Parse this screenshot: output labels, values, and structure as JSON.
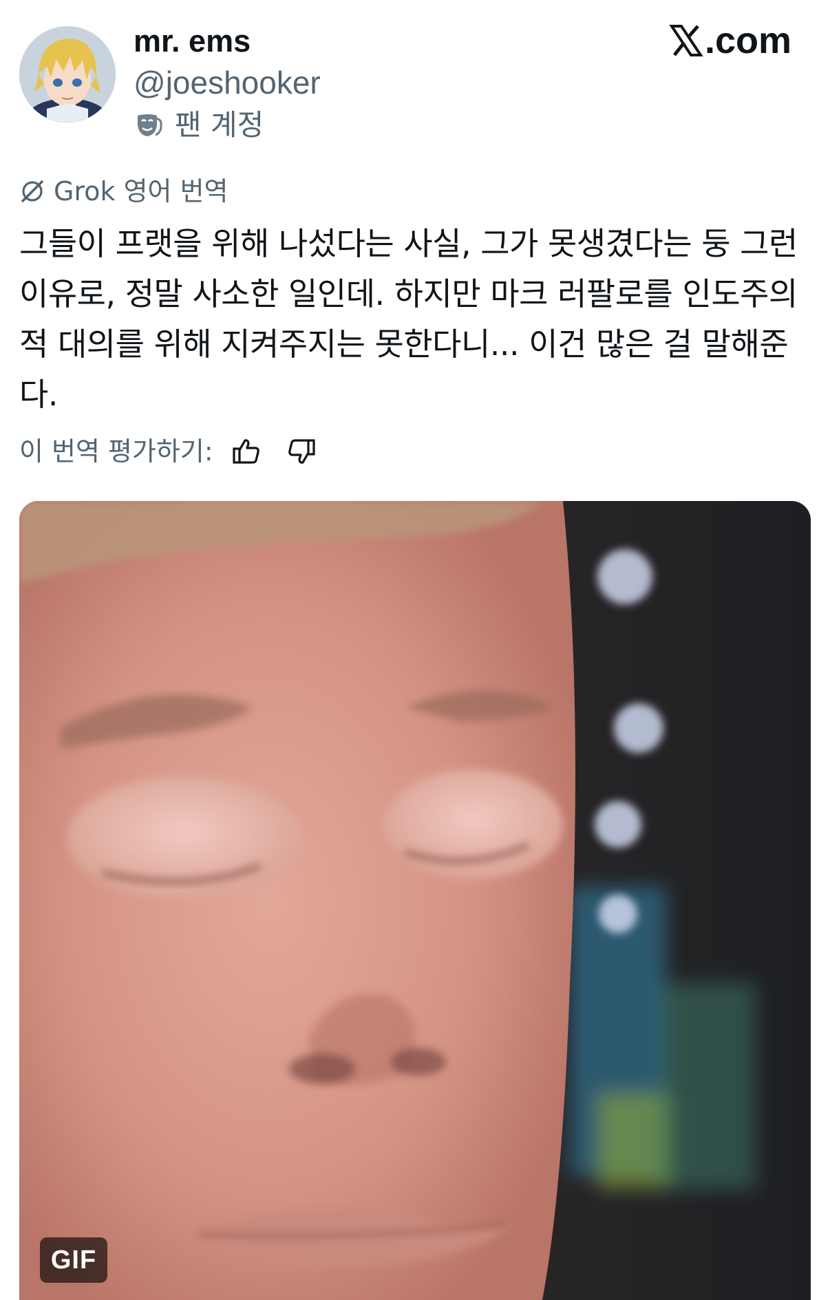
{
  "author": {
    "display_name": "mr. ems",
    "handle": "@joeshooker",
    "badge_label": "팬 계정",
    "badge_icon": "theater-mask-icon",
    "avatar_icon": "anime-character-avatar"
  },
  "brand": {
    "label": ".com",
    "icon": "x-logo-icon"
  },
  "translation": {
    "icon": "grok-icon",
    "source_label": "Grok 영어 번역",
    "rate_label": "이 번역 평가하기:",
    "thumbs_up_icon": "thumbs-up-icon",
    "thumbs_down_icon": "thumbs-down-icon"
  },
  "tweet": {
    "text": "그들이 프랫을 위해 나섰다는 사실, 그가 못생겼다는 둥 그런 이유로, 정말 사소한 일인데. 하지만 마크 러팔로를 인도주의적 대의를 위해 지켜주지는 못한다니... 이건 많은 걸 말해준다."
  },
  "media": {
    "type_badge": "GIF",
    "description_icon": "closed-eyes-face-gif"
  },
  "colors": {
    "text_primary": "#0f1419",
    "text_secondary": "#536471",
    "background": "#ffffff"
  }
}
